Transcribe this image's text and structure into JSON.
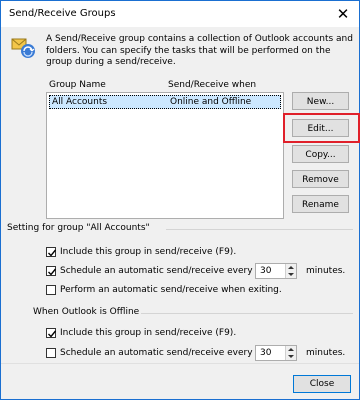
{
  "window": {
    "title": "Send/Receive Groups"
  },
  "description": "A Send/Receive group contains a collection of Outlook accounts and folders. You can specify the tasks that will be performed on the group during a send/receive.",
  "list": {
    "col_group_name": "Group Name",
    "col_send_receive_when": "Send/Receive when",
    "rows": [
      {
        "name": "All Accounts",
        "when": "Online and Offline",
        "selected": true
      }
    ]
  },
  "buttons": {
    "new": "New...",
    "edit": "Edit...",
    "copy": "Copy...",
    "remove": "Remove",
    "rename": "Rename",
    "close": "Close"
  },
  "online_section": {
    "label": "Setting for group \"All Accounts\"",
    "include_label": "Include this group in send/receive (F9).",
    "include_checked": true,
    "schedule_label": "Schedule an automatic send/receive every",
    "schedule_checked": true,
    "schedule_value": "30",
    "minutes_label": "minutes.",
    "exit_label": "Perform an automatic send/receive when exiting.",
    "exit_checked": false
  },
  "offline_section": {
    "label": "When Outlook is Offline",
    "include_label": "Include this group in send/receive (F9).",
    "include_checked": true,
    "schedule_label": "Schedule an automatic send/receive every",
    "schedule_checked": false,
    "schedule_value": "30",
    "minutes_label": "minutes."
  },
  "colors": {
    "accent": "#0078d7",
    "selection": "#cce8ff",
    "highlight_box": "#e0202a"
  },
  "icons": {
    "close": "close-icon",
    "app": "send-receive-groups-icon",
    "check": "checkmark-icon"
  }
}
